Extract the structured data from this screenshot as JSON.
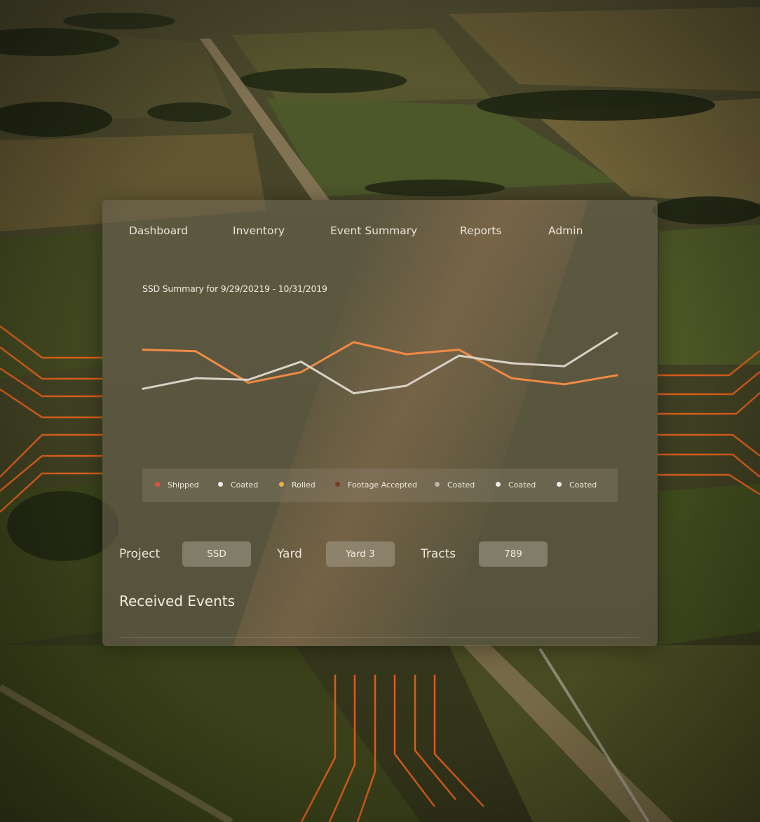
{
  "nav": {
    "items": [
      "Dashboard",
      "Inventory",
      "Event Summary",
      "Reports",
      "Admin"
    ]
  },
  "chart_data": {
    "type": "line",
    "title": "SSD Summary for 9/29/20219 - 10/31/2019",
    "xlabel": "",
    "ylabel": "",
    "x": [
      1,
      2,
      3,
      4,
      5,
      6,
      7,
      8,
      9,
      10
    ],
    "series": [
      {
        "color": "#f08a45",
        "values": [
          52,
          51,
          30,
          37,
          57,
          49,
          52,
          33,
          29,
          35
        ]
      },
      {
        "color": "#d8d2c6",
        "values": [
          26,
          33,
          32,
          44,
          23,
          28,
          48,
          43,
          41,
          63
        ]
      }
    ],
    "ylim": [
      0,
      70
    ],
    "grid": false,
    "legend": "bottom"
  },
  "legend": [
    {
      "label": "Shipped",
      "color": "#e0523a"
    },
    {
      "label": "Coated",
      "color": "#f2eeea"
    },
    {
      "label": "Rolled",
      "color": "#e9b04a"
    },
    {
      "label": "Footage Accepted",
      "color": "#7a3a1e"
    },
    {
      "label": "Coated",
      "color": "#b9b4ab"
    },
    {
      "label": "Coated",
      "color": "#f2eeea"
    },
    {
      "label": "Coated",
      "color": "#f2eeea"
    }
  ],
  "filters": {
    "project_label": "Project",
    "project_value": "SSD",
    "yard_label": "Yard",
    "yard_value": "Yard 3",
    "tracts_label": "Tracts",
    "tracts_value": "789"
  },
  "received_events_title": "Received Events",
  "colors": {
    "accent": "#e8611c",
    "panel": "#6c6652"
  }
}
